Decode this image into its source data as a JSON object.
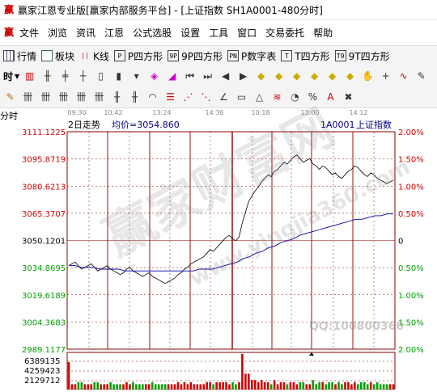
{
  "titlebar": {
    "title": "赢家江恩专业版[赢家内部服务平台] - [上证指数 SH1A0001-480分时]"
  },
  "menubar": {
    "items": [
      "文件",
      "浏览",
      "资讯",
      "江恩",
      "公式选股",
      "设置",
      "工具",
      "窗口",
      "交易委托",
      "帮助"
    ]
  },
  "toolbar1": {
    "buttons": [
      {
        "label": "行情",
        "icon": "quote-grid-icon"
      },
      {
        "label": "板块",
        "icon": "sector-grid-icon"
      },
      {
        "label": "K线",
        "icon": "kline-icon"
      },
      {
        "label": "P四方形",
        "icon": "P"
      },
      {
        "label": "9P四方形",
        "icon": "9P"
      },
      {
        "label": "P数字表",
        "icon": "PN"
      },
      {
        "label": "T四方形",
        "icon": "T"
      },
      {
        "label": "9T四方形",
        "icon": "T9"
      }
    ]
  },
  "toolbar2": {
    "period": "时"
  },
  "toolbar3": {},
  "chart": {
    "header": {
      "period_label": "分时",
      "title": "2日走势",
      "avg_label": "均价=3054.860",
      "code": "1A0001",
      "name": "上证指数"
    },
    "time_ticks": [
      "09:30",
      "10:42",
      "13:24",
      "14:36",
      "10:18",
      "13:00",
      "14:12"
    ],
    "price_labels": [
      "3111.1225",
      "3095.8719",
      "3080.6213",
      "3065.3707",
      "3050.1201",
      "3034.8695",
      "3019.6189",
      "3004.3683",
      "2989.1177"
    ],
    "pct_labels": [
      "2.00%",
      "1.50%",
      "1.00%",
      "0.50%",
      "0",
      "0.50%",
      "1.00%",
      "1.50%",
      "2.00%"
    ],
    "vol_labels": [
      "6389135",
      "4259423",
      "2129712"
    ],
    "watermark_main": "赢家财富网",
    "watermark_url": "www.yingjia360.com",
    "watermark_qq": "QQ:100800360",
    "colors": {
      "up": "#d00000",
      "down": "#00a000",
      "grid": "#8b0000",
      "price_line": "#000000",
      "avg_line": "#0000a0",
      "volume": "#00a000"
    },
    "chart_data": {
      "type": "line",
      "title": "2日走势",
      "ylim": [
        2989.1177,
        3111.1225
      ],
      "x_ticks": [
        "09:30",
        "10:42",
        "13:24",
        "14:36",
        "10:18",
        "13:00",
        "14:12"
      ],
      "series": [
        {
          "values": [
            3036,
            3037,
            3038,
            3036,
            3034,
            3035,
            3036,
            3037,
            3035,
            3033,
            3034,
            3035,
            3036,
            3034,
            3033,
            3032,
            3031,
            3032,
            3034,
            3035,
            3033,
            3032,
            3031,
            3030,
            3031,
            3032,
            3030,
            3029,
            3028,
            3027,
            3026,
            3027,
            3028,
            3029,
            3031,
            3032,
            3034,
            3035,
            3037,
            3038,
            3039,
            3040,
            3041,
            3043,
            3045,
            3044,
            3046,
            3048,
            3050,
            3052,
            3053,
            3051,
            3050,
            3052,
            3060,
            3066,
            3072,
            3075,
            3078,
            3080,
            3083,
            3085,
            3087,
            3086,
            3089,
            3090,
            3092,
            3094,
            3093,
            3095,
            3097,
            3098,
            3096,
            3094,
            3095,
            3096,
            3093,
            3092,
            3090,
            3092,
            3091,
            3089,
            3087,
            3088,
            3086,
            3085,
            3087,
            3089,
            3090,
            3092,
            3091,
            3089,
            3087,
            3086,
            3088,
            3087,
            3085,
            3084,
            3083,
            3082,
            3083,
            3084
          ]
        },
        {
          "values": [
            3036,
            3036,
            3035,
            3035,
            3035,
            3034,
            3034,
            3034,
            3034,
            3033,
            3033,
            3033,
            3033,
            3033,
            3033,
            3033,
            3033,
            3033,
            3033,
            3033,
            3033,
            3034,
            3034,
            3034,
            3035,
            3036,
            3037,
            3038,
            3040,
            3041,
            3043,
            3044,
            3046,
            3047,
            3049,
            3050,
            3051,
            3053,
            3054,
            3055,
            3056,
            3057,
            3058,
            3059,
            3060,
            3061,
            3062,
            3062,
            3063,
            3064,
            3064,
            3065,
            3065
          ]
        }
      ]
    }
  }
}
